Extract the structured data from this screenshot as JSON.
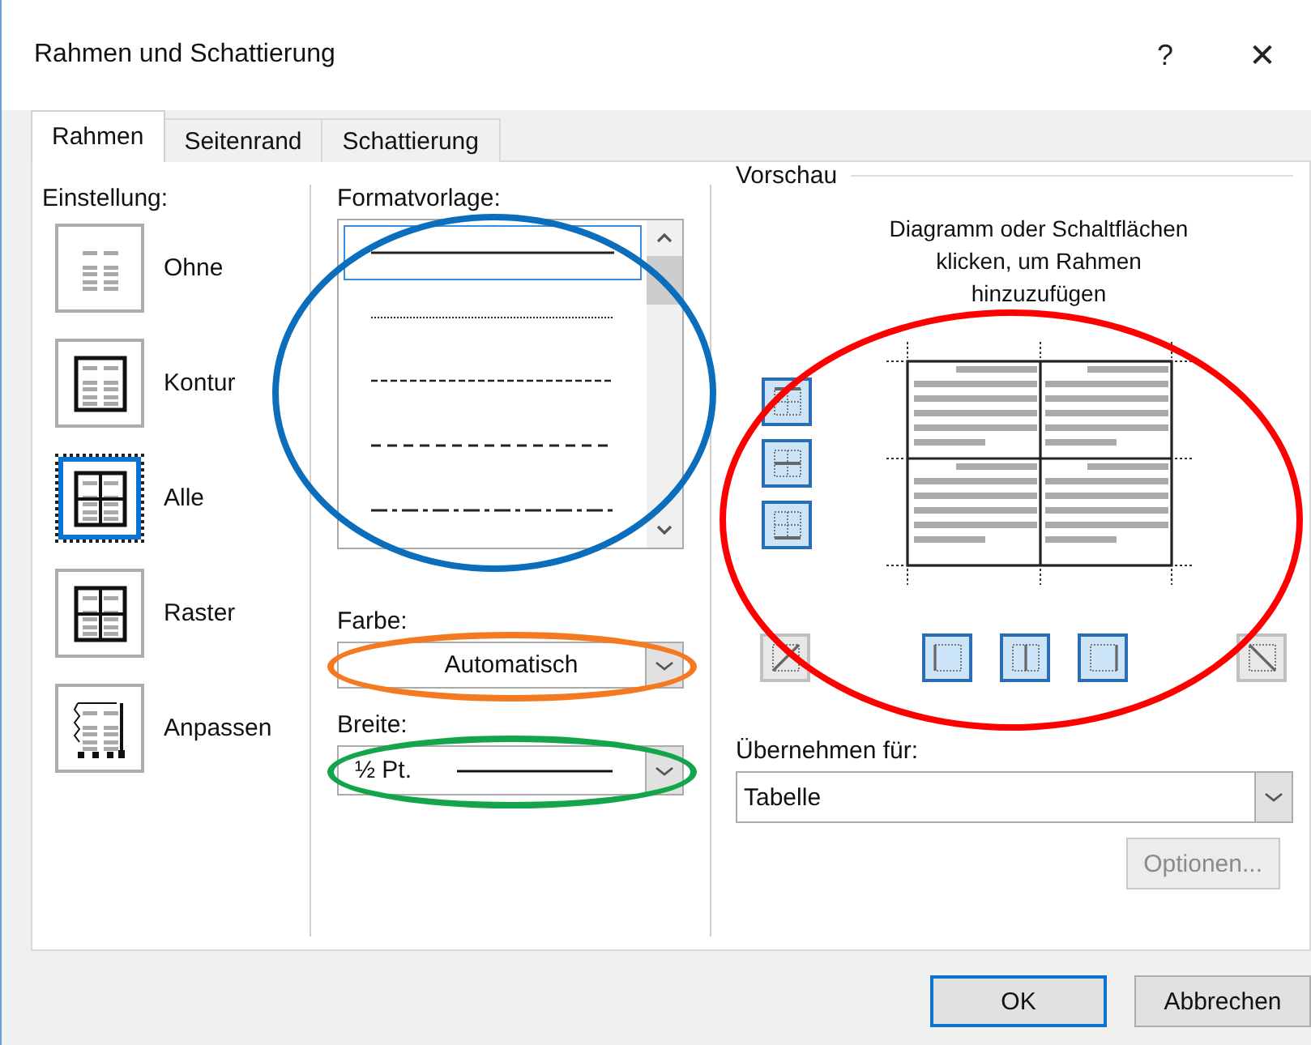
{
  "window": {
    "title": "Rahmen und Schattierung",
    "help_glyph": "?",
    "close_glyph": "✕"
  },
  "tabs": [
    {
      "label": "Rahmen",
      "selected": true
    },
    {
      "label": "Seitenrand",
      "selected": false
    },
    {
      "label": "Schattierung",
      "selected": false
    }
  ],
  "setting": {
    "label": "Einstellung:",
    "items": [
      {
        "kind": "none",
        "label": "Ohne",
        "selected": false
      },
      {
        "kind": "box",
        "label": "Kontur",
        "selected": false
      },
      {
        "kind": "all",
        "label": "Alle",
        "selected": true
      },
      {
        "kind": "grid",
        "label": "Raster",
        "selected": false
      },
      {
        "kind": "custom",
        "label": "Anpassen",
        "selected": false
      }
    ]
  },
  "style": {
    "label": "Formatvorlage:",
    "annotation": {
      "color": "#0a6ebd"
    },
    "items": [
      {
        "kind": "solid",
        "selected": true
      },
      {
        "kind": "dotted",
        "selected": false
      },
      {
        "kind": "dashed",
        "selected": false
      },
      {
        "kind": "dashed-wide",
        "selected": false
      },
      {
        "kind": "dash-dot",
        "selected": false
      }
    ]
  },
  "color": {
    "label": "Farbe:",
    "value": "Automatisch",
    "annotation": {
      "color": "#f47920"
    }
  },
  "width": {
    "label": "Breite:",
    "value": "½ Pt.",
    "annotation": {
      "color": "#14a54a"
    }
  },
  "preview": {
    "label": "Vorschau",
    "caption": "Diagramm oder Schaltflächen klicken, um Rahmen hinzuzufügen",
    "annotation": {
      "color": "#ff0000"
    },
    "side_buttons": [
      {
        "kind": "top",
        "on": true
      },
      {
        "kind": "middle-h",
        "on": true
      },
      {
        "kind": "bottom",
        "on": true
      }
    ],
    "bottom_buttons": [
      {
        "kind": "diag-up",
        "on": false
      },
      {
        "kind": "left",
        "on": true
      },
      {
        "kind": "middle-v",
        "on": true
      },
      {
        "kind": "right",
        "on": true
      },
      {
        "kind": "diag-down",
        "on": false
      }
    ]
  },
  "apply_to": {
    "label": "Übernehmen für:",
    "value": "Tabelle"
  },
  "options_button": {
    "label": "Optionen...",
    "disabled": true
  },
  "buttons": [
    {
      "label": "OK",
      "default": true
    },
    {
      "label": "Abbrechen",
      "default": false
    }
  ]
}
